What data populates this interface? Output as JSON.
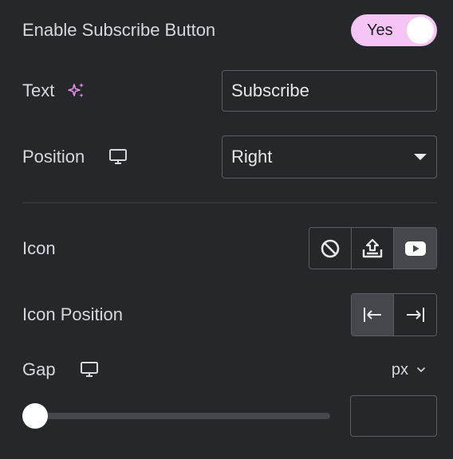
{
  "enable_subscribe": {
    "label": "Enable Subscribe Button",
    "toggle_label": "Yes",
    "on": true,
    "toggle_color": "#f5c6f5"
  },
  "text_field": {
    "label": "Text",
    "label_icon": "ai-sparkle-icon",
    "value": "Subscribe"
  },
  "position_field": {
    "label": "Position",
    "label_icon": "desktop-icon",
    "selected": "Right"
  },
  "icon_field": {
    "label": "Icon",
    "options": [
      {
        "icon": "none-icon",
        "active": false
      },
      {
        "icon": "upload-icon",
        "active": false
      },
      {
        "icon": "youtube-icon",
        "active": true
      }
    ]
  },
  "icon_position_field": {
    "label": "Icon Position",
    "options": [
      {
        "icon": "align-start-icon",
        "active": true
      },
      {
        "icon": "align-end-icon",
        "active": false
      }
    ]
  },
  "gap_field": {
    "label": "Gap",
    "label_icon": "desktop-icon",
    "unit": "px",
    "value": "",
    "slider_fraction": 0
  }
}
